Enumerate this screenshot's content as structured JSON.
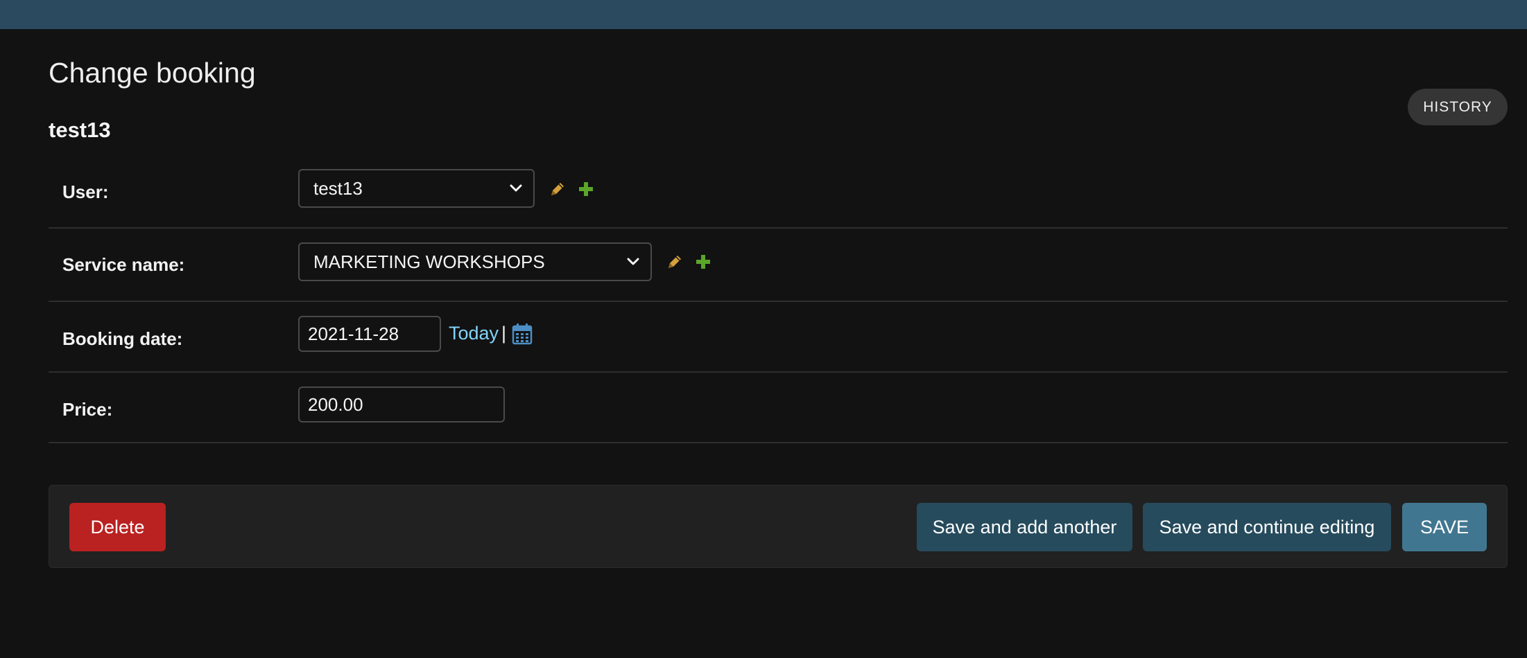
{
  "header": {
    "page_title": "Change booking",
    "object_title": "test13",
    "history_label": "HISTORY"
  },
  "form": {
    "user": {
      "label": "User:",
      "value": "test13"
    },
    "service_name": {
      "label": "Service name:",
      "value": "MARKETING WORKSHOPS"
    },
    "booking_date": {
      "label": "Booking date:",
      "value": "2021-11-28",
      "today_label": "Today",
      "separator": "|"
    },
    "price": {
      "label": "Price:",
      "value": "200.00"
    }
  },
  "actions": {
    "delete_label": "Delete",
    "save_add_another_label": "Save and add another",
    "save_continue_label": "Save and continue editing",
    "save_label": "SAVE"
  },
  "colors": {
    "topbar": "#2c4a5f",
    "background": "#121212",
    "link": "#81d4fa",
    "edit_icon": "#d4a13c",
    "add_icon": "#5aa52a",
    "delete_button": "#ba2121",
    "secondary_button": "#264b5d",
    "save_button": "#417690"
  },
  "icons": {
    "edit": "pencil-icon",
    "add": "plus-icon",
    "calendar": "calendar-icon",
    "select": "chevron-down-icon"
  }
}
